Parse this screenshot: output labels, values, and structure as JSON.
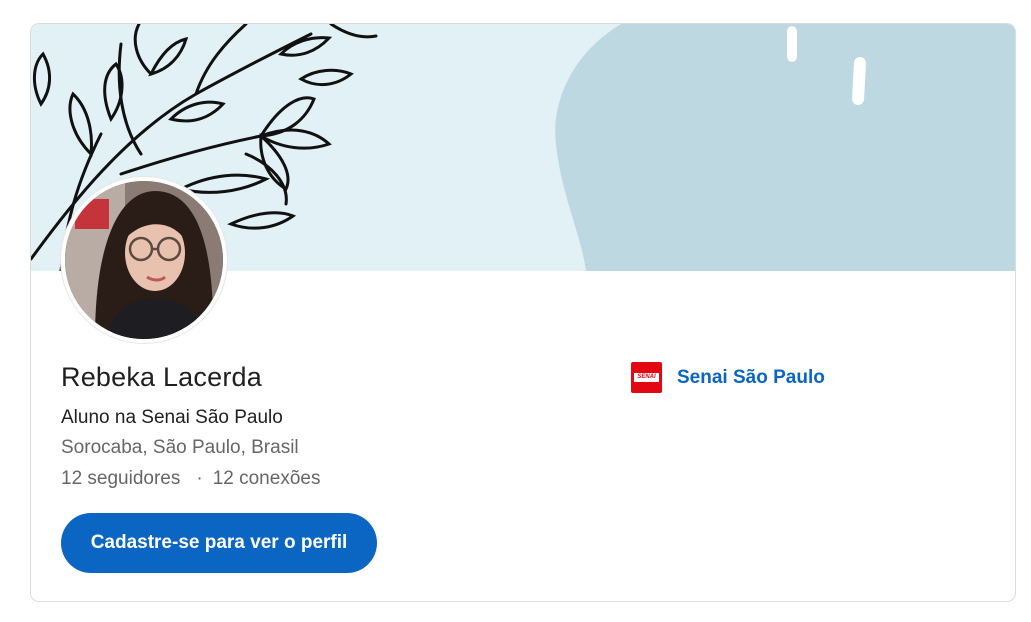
{
  "profile": {
    "name": "Rebeka Lacerda",
    "headline": "Aluno na Senai São Paulo",
    "location": "Sorocaba, São Paulo, Brasil",
    "followers": "12 seguidores",
    "separator": "·",
    "connections": "12 conexões"
  },
  "cta": {
    "label": "Cadastre-se para ver o perfil"
  },
  "organization": {
    "name": "Senai São Paulo",
    "logo_text": "SENAI"
  },
  "colors": {
    "accent": "#0a66c2",
    "banner_bg": "#e1f1f5",
    "banner_shape": "#bed8e1",
    "org_logo": "#e30613"
  }
}
